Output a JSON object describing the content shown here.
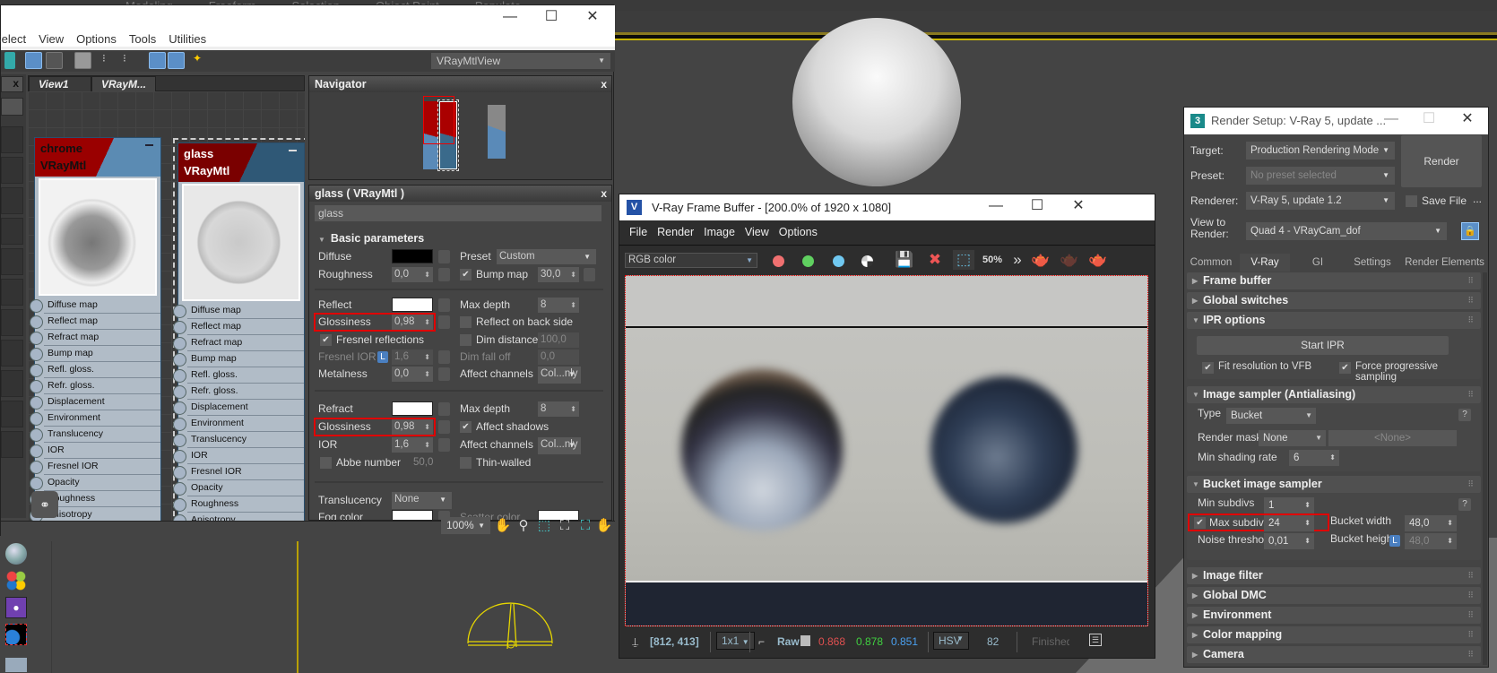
{
  "app_ribbon_tabs": [
    "Modeling",
    "Freeform",
    "Selection",
    "Object Paint",
    "Populate"
  ],
  "material_editor": {
    "menu": [
      "Select",
      "View",
      "Options",
      "Tools",
      "Utilities"
    ],
    "view_dropdown": "VRayMtlView",
    "view_tabs": [
      "View1",
      "VRayM..."
    ],
    "navigator_title": "Navigator",
    "nodes": [
      {
        "name": "chrome",
        "type": "VRayMtl",
        "selected": false
      },
      {
        "name": "glass",
        "type": "VRayMtl",
        "selected": true
      }
    ],
    "slots": [
      "Diffuse map",
      "Reflect map",
      "Refract map",
      "Bump map",
      "Refl. gloss.",
      "Refr. gloss.",
      "Displacement",
      "Environment",
      "Translucency",
      "IOR",
      "Fresnel IOR",
      "Opacity",
      "Roughness",
      "Anisotropy"
    ],
    "params": {
      "title": "glass  ( VRayMtl )",
      "name": "glass",
      "rollout": "Basic parameters",
      "diffuse_label": "Diffuse",
      "diffuse_color": "#000000",
      "roughness_label": "Roughness",
      "roughness": "0,0",
      "preset_label": "Preset",
      "preset": "Custom",
      "bump_label": "Bump map",
      "bump": "30,0",
      "reflect_label": "Reflect",
      "reflect_color": "#ffffff",
      "refl_gloss_label": "Glossiness",
      "refl_gloss": "0,98",
      "max_depth_label": "Max depth",
      "refl_max_depth": "8",
      "reflect_back_label": "Reflect on back side",
      "fresnel_label": "Fresnel reflections",
      "dim_distance_label": "Dim distance",
      "dim_distance": "100,0",
      "fresnel_ior_label": "Fresnel IOR",
      "fresnel_ior_lock": "L",
      "fresnel_ior": "1,6",
      "dim_falloff_label": "Dim fall off",
      "dim_falloff": "0,0",
      "metalness_label": "Metalness",
      "metalness": "0,0",
      "affect_channels_label": "Affect channels",
      "refl_affect_channels": "Col...nly",
      "refract_label": "Refract",
      "refract_color": "#ffffff",
      "refr_gloss_label": "Glossiness",
      "refr_gloss": "0,98",
      "refr_max_depth": "8",
      "affect_shadows_label": "Affect shadows",
      "ior_label": "IOR",
      "ior": "1,6",
      "refr_affect_channels": "Col...nly",
      "abbe_label": "Abbe number",
      "abbe": "50,0",
      "thin_walled_label": "Thin-walled",
      "translucency_label": "Translucency",
      "translucency": "None",
      "fog_color_label": "Fog color",
      "scatter_color_label": "Scatter color"
    },
    "zoom": "100%"
  },
  "vfb": {
    "title": "V-Ray Frame Buffer - [200.0% of 1920 x 1080]",
    "menu": [
      "File",
      "Render",
      "Image",
      "View",
      "Options"
    ],
    "channel": "RGB color",
    "zoom_icon_text": "50%",
    "status": {
      "coords": "[812, 413]",
      "sample_size": "1x1",
      "raw_label": "Raw",
      "r": "0.868",
      "g": "0.878",
      "b": "0.851",
      "color_mode": "HSV",
      "hsv_value": "82",
      "progress_text": "Finished"
    },
    "colors": {
      "red": "#e05050",
      "green": "#40d040",
      "blue": "#4aa0f0"
    }
  },
  "render_setup": {
    "title": "Render Setup: V-Ray 5, update ...",
    "target_label": "Target:",
    "target": "Production Rendering Mode",
    "preset_label": "Preset:",
    "preset": "No preset selected",
    "renderer_label": "Renderer:",
    "renderer": "V-Ray 5, update 1.2",
    "save_file_label": "Save File",
    "more": "...",
    "view_label": "View to Render:",
    "view": "Quad 4 - VRayCam_dof",
    "render_button": "Render",
    "tabs": [
      "Common",
      "V-Ray",
      "GI",
      "Settings",
      "Render Elements"
    ],
    "active_tab": "V-Ray",
    "rollouts": {
      "frame_buffer": "Frame buffer",
      "global_switches": "Global switches",
      "ipr": "IPR options",
      "start_ipr": "Start IPR",
      "fit_resolution": "Fit resolution to VFB",
      "force_progressive": "Force progressive sampling",
      "image_sampler": "Image sampler (Antialiasing)",
      "type_label": "Type",
      "type": "Bucket",
      "render_mask_label": "Render mask",
      "render_mask": "None",
      "render_mask_obj": "<None>",
      "min_shading_label": "Min shading rate",
      "min_shading": "6",
      "bucket_sampler": "Bucket image sampler",
      "min_subdivs_label": "Min subdivs",
      "min_subdivs": "1",
      "max_subdivs_label": "Max subdivs",
      "max_subdivs": "24",
      "noise_label": "Noise threshold",
      "noise": "0,01",
      "bucket_width_label": "Bucket width",
      "bucket_width": "48,0",
      "bucket_height_label": "Bucket height",
      "bucket_height": "48,0",
      "help": "?",
      "lock": "L",
      "image_filter": "Image filter",
      "global_dmc": "Global DMC",
      "environment": "Environment",
      "color_mapping": "Color mapping",
      "camera": "Camera"
    }
  }
}
